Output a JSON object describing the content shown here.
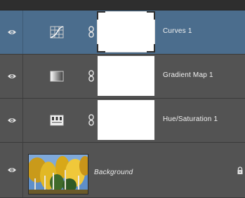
{
  "layers": [
    {
      "name": "Curves 1",
      "selected": true,
      "icon": "curves-icon",
      "visible": true
    },
    {
      "name": "Gradient Map 1",
      "selected": false,
      "icon": "gradient-map-icon",
      "visible": true
    },
    {
      "name": "Hue/Saturation 1",
      "selected": false,
      "icon": "hue-saturation-icon",
      "visible": true
    },
    {
      "name": "Background",
      "selected": false,
      "icon": "image-thumbnail",
      "visible": true,
      "locked": true
    }
  ],
  "colors": {
    "panel_bg": "#535353",
    "selected_bg": "#4b6d8d",
    "text": "#f2f2f2"
  }
}
